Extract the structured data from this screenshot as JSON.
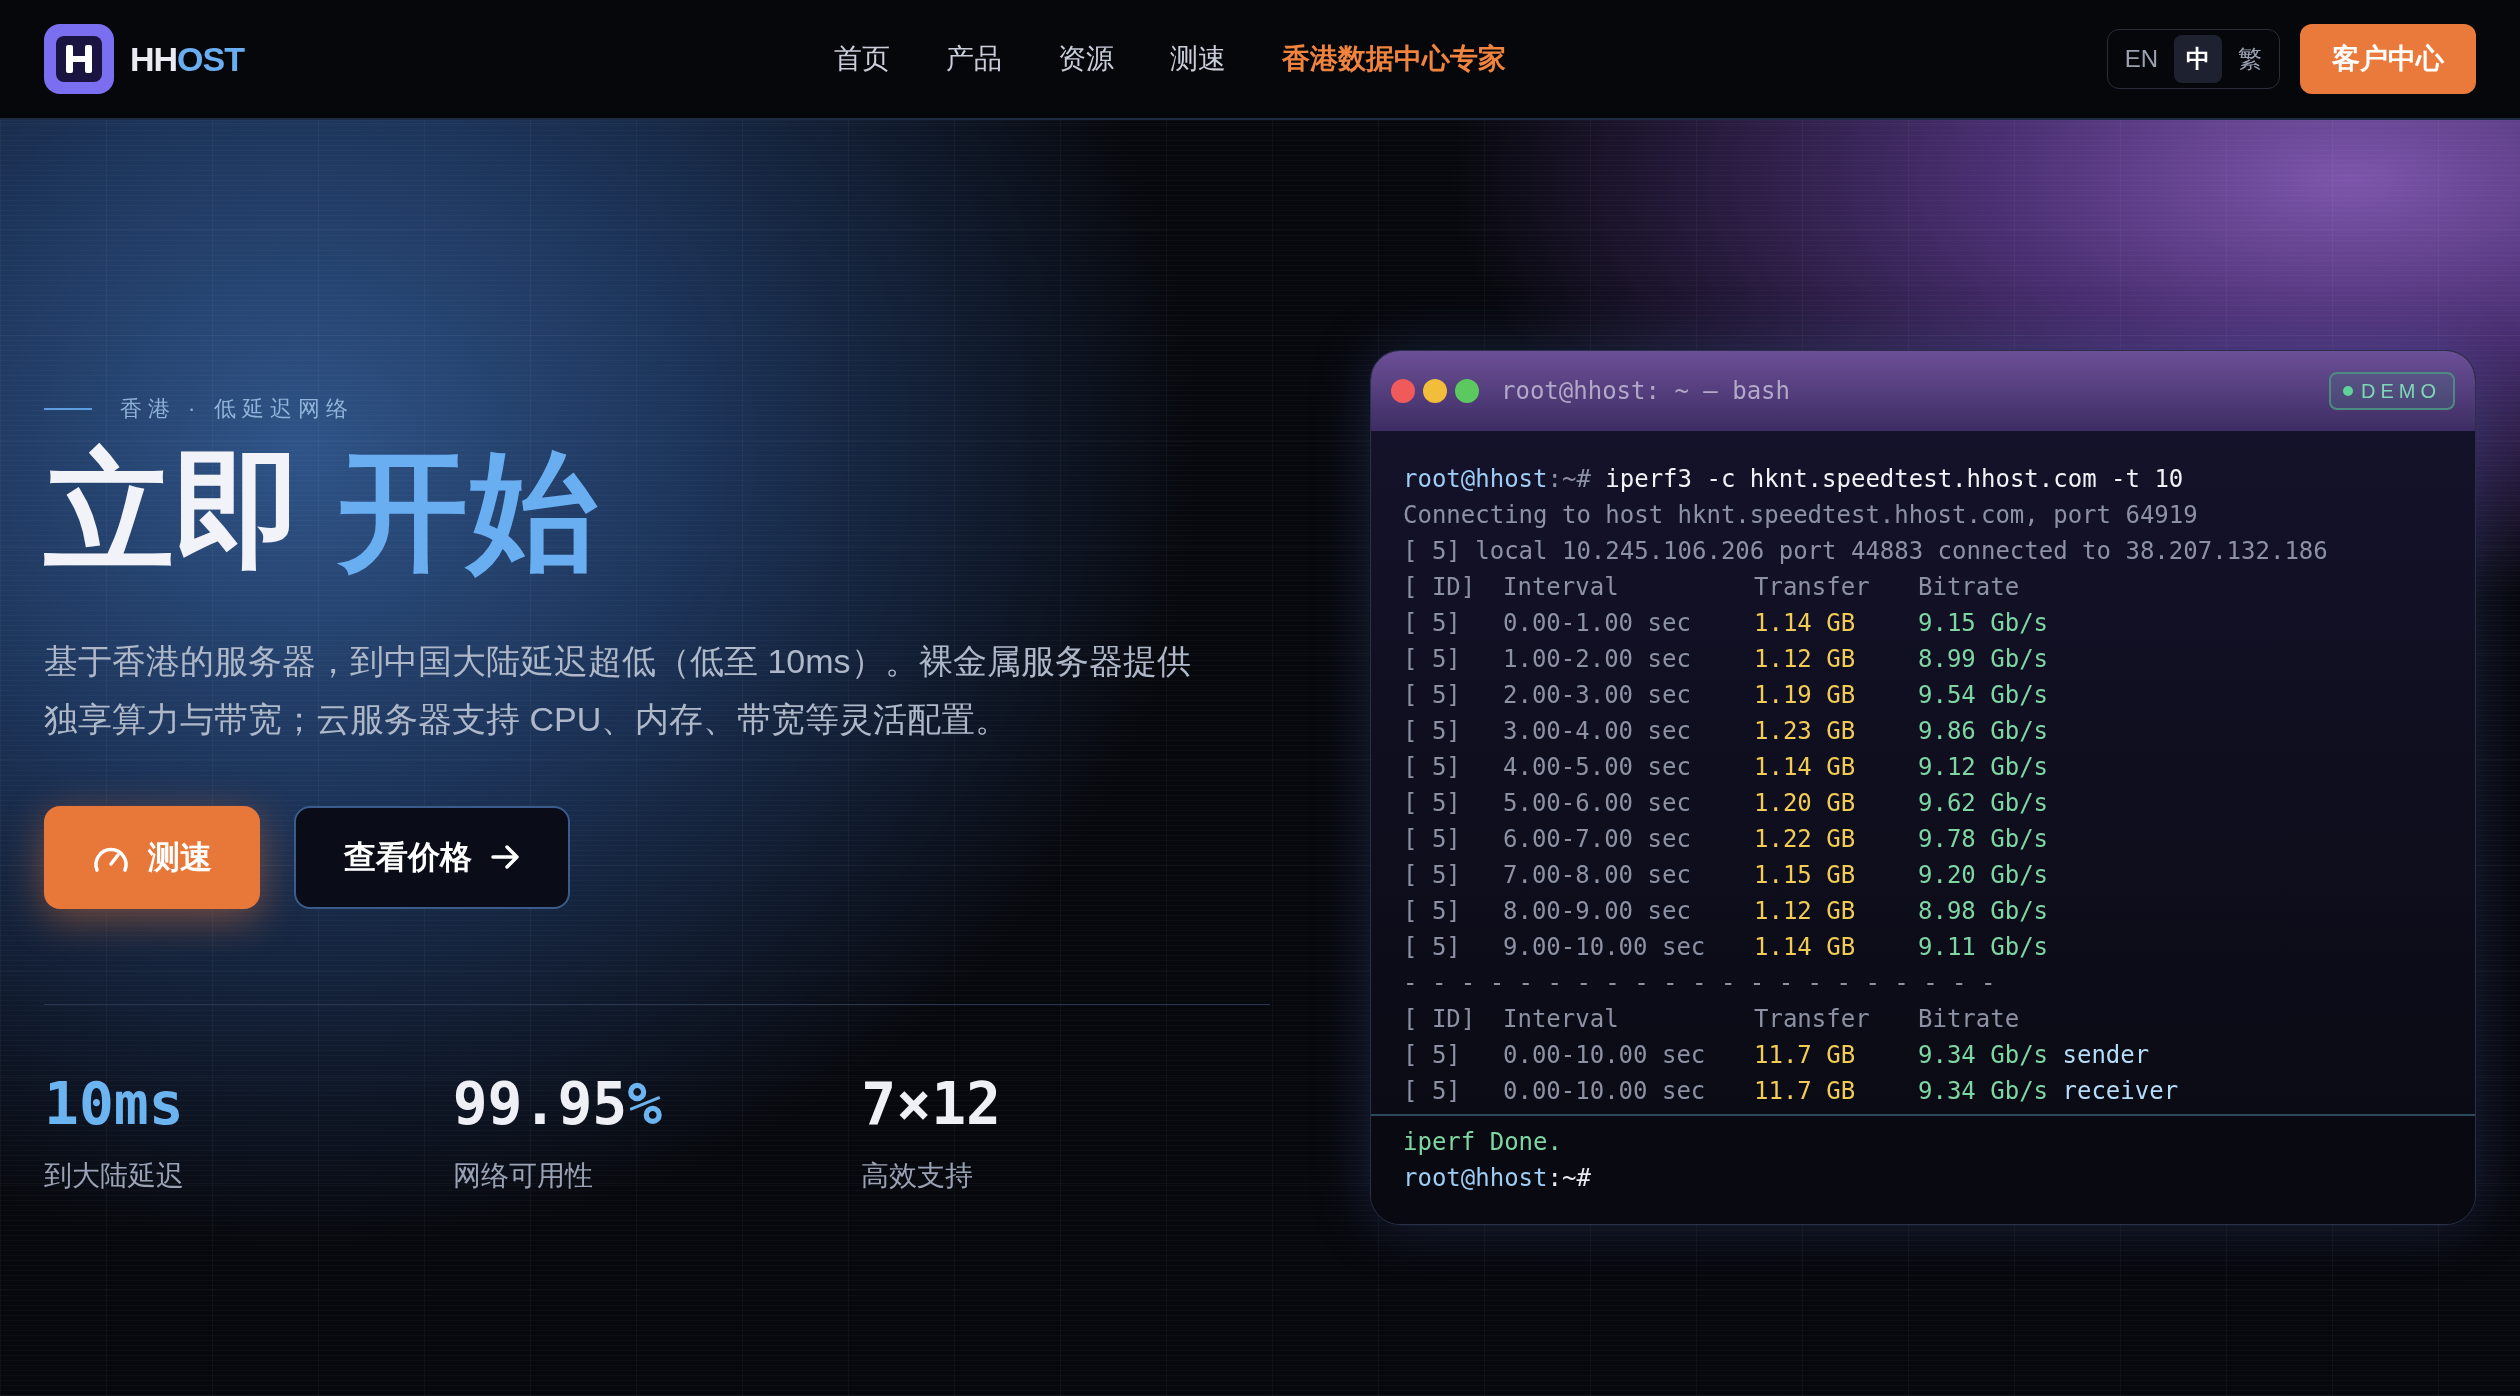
{
  "brand": {
    "parts": [
      {
        "text": "HH",
        "accent": false
      },
      {
        "text": "OST",
        "accent": true
      }
    ]
  },
  "nav": [
    {
      "label": "首页",
      "highlight": false
    },
    {
      "label": "产品",
      "highlight": false
    },
    {
      "label": "资源",
      "highlight": false
    },
    {
      "label": "测速",
      "highlight": false
    },
    {
      "label": "香港数据中心专家",
      "highlight": true
    }
  ],
  "languages": [
    {
      "label": "EN",
      "selected": false
    },
    {
      "label": "中",
      "selected": true
    },
    {
      "label": "繁",
      "selected": false
    }
  ],
  "client_button": "客户中心",
  "hero": {
    "tagline": "香港 · 低延迟网络",
    "title": [
      {
        "text": "立即",
        "accent": false
      },
      {
        "text": "开始",
        "accent": true
      }
    ],
    "description": "基于香港的服务器，到中国大陆延迟超低（低至 10ms）。裸金属服务器提供独享算力与带宽；云服务器支持 CPU、内存、带宽等灵活配置。",
    "buttons": [
      {
        "label": "测速",
        "kind": "primary"
      },
      {
        "label": "查看价格",
        "kind": "secondary"
      }
    ],
    "stats": [
      {
        "value": [
          {
            "text": "10ms",
            "accent": true
          }
        ],
        "label": "到大陆延迟"
      },
      {
        "value": [
          {
            "text": "99.95",
            "accent": false
          },
          {
            "text": "%",
            "accent": true
          }
        ],
        "label": "网络可用性"
      },
      {
        "value": [
          {
            "text": "7×12",
            "accent": false
          }
        ],
        "label": "高效支持"
      }
    ]
  },
  "terminal": {
    "title": "root@hhost: ~ — bash",
    "badge": "DEMO",
    "lines": [
      {
        "kind": "command",
        "user": "root@hhost",
        "path": ":~#",
        "command": "iperf3 -c hknt.speedtest.hhost.com -t 10"
      },
      {
        "kind": "text",
        "text": "Connecting to host hknt.speedtest.hhost.com, port 64919"
      },
      {
        "kind": "text",
        "text": "[ 5] local 10.245.106.206 port 44883 connected to 38.207.132.186"
      },
      {
        "kind": "header",
        "id": "[ ID]",
        "interval": "Interval",
        "transfer": "Transfer",
        "bitrate": "Bitrate"
      },
      {
        "kind": "row",
        "id": "[ 5]",
        "interval": "0.00-1.00 sec",
        "transfer": "1.14 GB",
        "bitrate": "9.15 Gb/s"
      },
      {
        "kind": "row",
        "id": "[ 5]",
        "interval": "1.00-2.00 sec",
        "transfer": "1.12 GB",
        "bitrate": "8.99 Gb/s"
      },
      {
        "kind": "row",
        "id": "[ 5]",
        "interval": "2.00-3.00 sec",
        "transfer": "1.19 GB",
        "bitrate": "9.54 Gb/s"
      },
      {
        "kind": "row",
        "id": "[ 5]",
        "interval": "3.00-4.00 sec",
        "transfer": "1.23 GB",
        "bitrate": "9.86 Gb/s"
      },
      {
        "kind": "row",
        "id": "[ 5]",
        "interval": "4.00-5.00 sec",
        "transfer": "1.14 GB",
        "bitrate": "9.12 Gb/s"
      },
      {
        "kind": "row",
        "id": "[ 5]",
        "interval": "5.00-6.00 sec",
        "transfer": "1.20 GB",
        "bitrate": "9.62 Gb/s"
      },
      {
        "kind": "row",
        "id": "[ 5]",
        "interval": "6.00-7.00 sec",
        "transfer": "1.22 GB",
        "bitrate": "9.78 Gb/s"
      },
      {
        "kind": "row",
        "id": "[ 5]",
        "interval": "7.00-8.00 sec",
        "transfer": "1.15 GB",
        "bitrate": "9.20 Gb/s"
      },
      {
        "kind": "row",
        "id": "[ 5]",
        "interval": "8.00-9.00 sec",
        "transfer": "1.12 GB",
        "bitrate": "8.98 Gb/s"
      },
      {
        "kind": "row",
        "id": "[ 5]",
        "interval": "9.00-10.00 sec",
        "transfer": "1.14 GB",
        "bitrate": "9.11 Gb/s"
      },
      {
        "kind": "separator",
        "text": "- - - - - - - - - - - - - - - - - - - - -"
      },
      {
        "kind": "header",
        "id": "[ ID]",
        "interval": "Interval",
        "transfer": "Transfer",
        "bitrate": "Bitrate"
      },
      {
        "kind": "row",
        "id": "[ 5]",
        "interval": "0.00-10.00 sec",
        "transfer": "11.7 GB",
        "bitrate": "9.34 Gb/s",
        "role": "sender"
      },
      {
        "kind": "row",
        "id": "[ 5]",
        "interval": "0.00-10.00 sec",
        "transfer": "11.7 GB",
        "bitrate": "9.34 Gb/s",
        "role": "receiver"
      }
    ],
    "footer_lines": [
      {
        "kind": "done",
        "text": "iperf Done."
      },
      {
        "kind": "prompt",
        "user": "root@hhost",
        "path": ":~#"
      }
    ]
  }
}
